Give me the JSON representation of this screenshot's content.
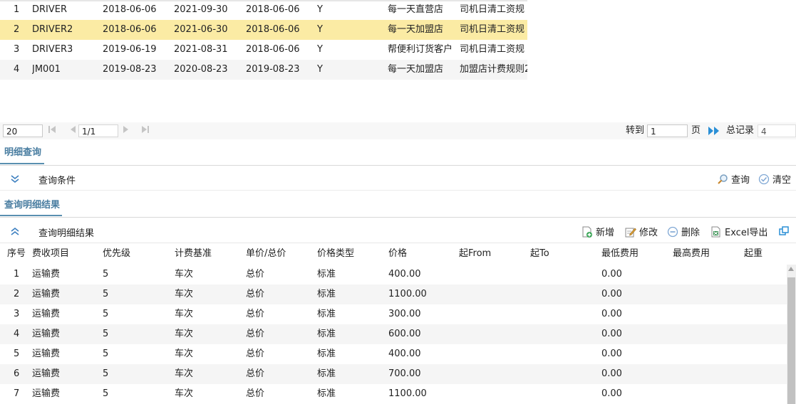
{
  "top_grid": {
    "rows": [
      {
        "no": "1",
        "code": "DRIVER",
        "d1": "2018-06-06",
        "d2": "2021-09-30",
        "d3": "2018-06-06",
        "flag": "Y",
        "group": "每一天直营店",
        "rule": "司机日清工资规"
      },
      {
        "no": "2",
        "code": "DRIVER2",
        "d1": "2018-06-06",
        "d2": "2021-06-30",
        "d3": "2018-06-06",
        "flag": "Y",
        "group": "每一天加盟店",
        "rule": "司机日清工资规"
      },
      {
        "no": "3",
        "code": "DRIVER3",
        "d1": "2019-06-19",
        "d2": "2021-08-31",
        "d3": "2018-06-06",
        "flag": "Y",
        "group": "帮便利订货客户",
        "rule": "司机日清工资规"
      },
      {
        "no": "4",
        "code": "JM001",
        "d1": "2019-08-23",
        "d2": "2020-08-23",
        "d3": "2019-08-23",
        "flag": "Y",
        "group": "每一天加盟店",
        "rule": "加盟店计费规则2"
      }
    ]
  },
  "pager": {
    "page_size": "20",
    "page_info": "1/1",
    "goto_label": "转到",
    "goto_value": "1",
    "page_unit": "页",
    "total_label": "总记录",
    "total_value": "4"
  },
  "tab_detail_query": "明细查询",
  "query_panel": {
    "title": "查询条件",
    "search_label": "查询",
    "clear_label": "清空"
  },
  "tab_detail_result": "查询明细结果",
  "result_panel": {
    "title": "查询明细结果",
    "add_label": "新增",
    "edit_label": "修改",
    "delete_label": "删除",
    "export_label": "Excel导出"
  },
  "detail_grid": {
    "headers": [
      "序号",
      "费收项目",
      "优先级",
      "计费基准",
      "单价/总价",
      "价格类型",
      "价格",
      "起From",
      "起To",
      "最低费用",
      "最高费用",
      "起重"
    ],
    "rows": [
      {
        "no": "1",
        "item": "运输费",
        "priority": "5",
        "basis": "车次",
        "price_mode": "总价",
        "price_type": "标准",
        "price": "400.00",
        "min_fee": "0.00"
      },
      {
        "no": "2",
        "item": "运输费",
        "priority": "5",
        "basis": "车次",
        "price_mode": "总价",
        "price_type": "标准",
        "price": "1100.00",
        "min_fee": "0.00"
      },
      {
        "no": "3",
        "item": "运输费",
        "priority": "5",
        "basis": "车次",
        "price_mode": "总价",
        "price_type": "标准",
        "price": "300.00",
        "min_fee": "0.00"
      },
      {
        "no": "4",
        "item": "运输费",
        "priority": "5",
        "basis": "车次",
        "price_mode": "总价",
        "price_type": "标准",
        "price": "600.00",
        "min_fee": "0.00"
      },
      {
        "no": "5",
        "item": "运输费",
        "priority": "5",
        "basis": "车次",
        "price_mode": "总价",
        "price_type": "标准",
        "price": "400.00",
        "min_fee": "0.00"
      },
      {
        "no": "6",
        "item": "运输费",
        "priority": "5",
        "basis": "车次",
        "price_mode": "总价",
        "price_type": "标准",
        "price": "700.00",
        "min_fee": "0.00"
      },
      {
        "no": "7",
        "item": "运输费",
        "priority": "5",
        "basis": "车次",
        "price_mode": "总价",
        "price_type": "标准",
        "price": "1100.00",
        "min_fee": "0.00"
      }
    ]
  },
  "colors": {
    "accent": "#4a7ea1",
    "selected_row": "#fbeba4",
    "alt_row": "#f5f5f5",
    "nav_blue": "#2a8fd6"
  },
  "icons": [
    "first-page-icon",
    "prev-page-icon",
    "next-page-icon",
    "last-page-icon",
    "goto-page-icon",
    "collapse-down-icon",
    "search-icon",
    "clear-icon",
    "collapse-up-icon",
    "add-icon",
    "edit-icon",
    "delete-icon",
    "excel-export-icon",
    "refresh-icon"
  ]
}
